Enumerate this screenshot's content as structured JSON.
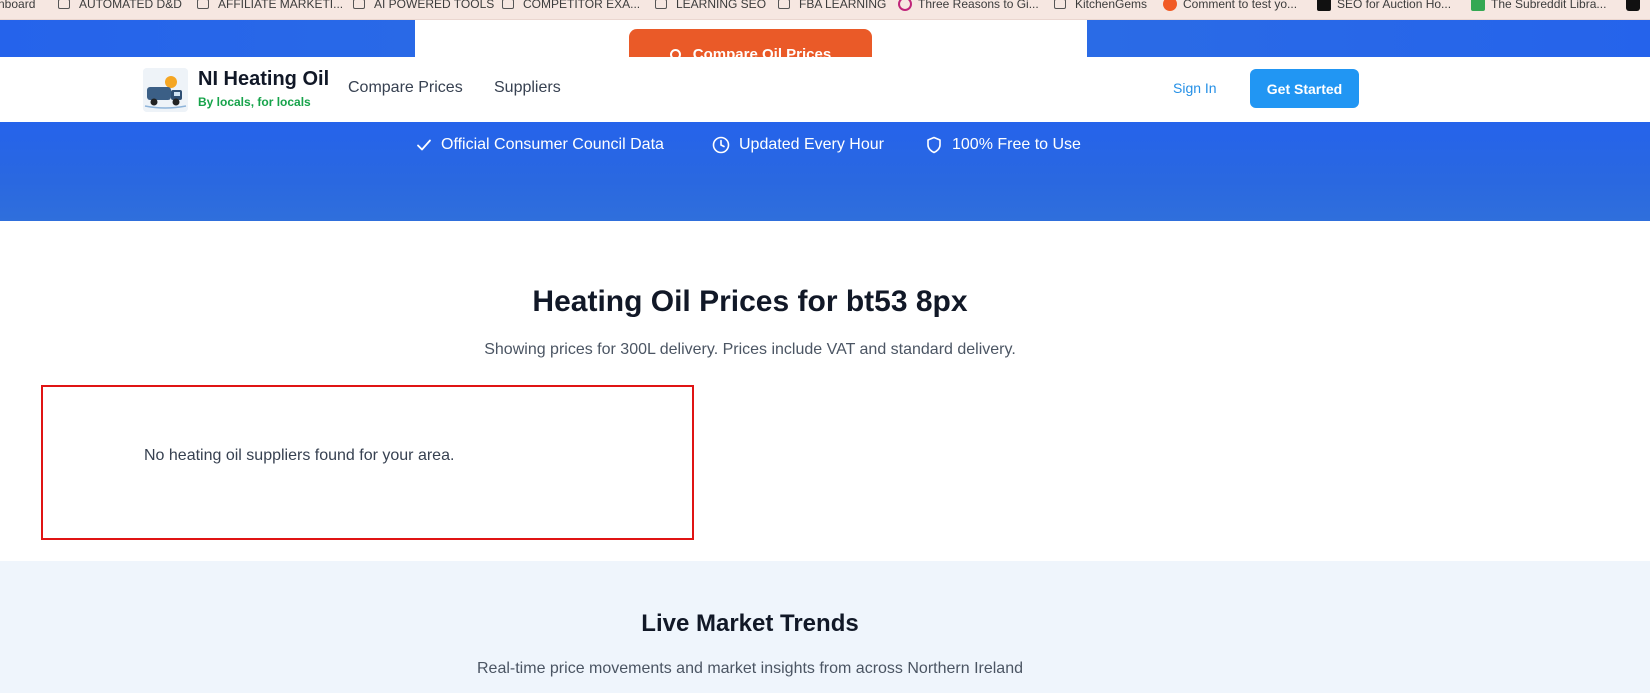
{
  "bookmarks": [
    {
      "label": "nboard",
      "icon": "none"
    },
    {
      "label": "AUTOMATED D&D",
      "icon": "folder-icon"
    },
    {
      "label": "AFFILIATE MARKETI...",
      "icon": "folder-icon"
    },
    {
      "label": "AI POWERED TOOLS",
      "icon": "folder-icon"
    },
    {
      "label": "COMPETITOR EXA...",
      "icon": "folder-icon"
    },
    {
      "label": "LEARNING SEO",
      "icon": "folder-icon"
    },
    {
      "label": "FBA LEARNING",
      "icon": "folder-icon"
    },
    {
      "label": "Three Reasons to Gi...",
      "icon": "site-favicon"
    },
    {
      "label": "KitchenGems",
      "icon": "folder-icon"
    },
    {
      "label": "Comment to test yo...",
      "icon": "site-favicon"
    },
    {
      "label": "SEO for Auction Ho...",
      "icon": "site-favicon"
    },
    {
      "label": "The Subreddit Libra...",
      "icon": "site-favicon"
    }
  ],
  "hero": {
    "compare_button": "Compare Oil Prices",
    "features": [
      {
        "label": "Official Consumer Council Data",
        "icon": "check-icon"
      },
      {
        "label": "Updated Every Hour",
        "icon": "clock-icon"
      },
      {
        "label": "100% Free to Use",
        "icon": "shield-icon"
      }
    ]
  },
  "nav": {
    "brand_title": "NI Heating Oil",
    "brand_tagline": "By locals, for locals",
    "links": [
      "Compare Prices",
      "Suppliers"
    ],
    "sign_in": "Sign In",
    "get_started": "Get Started"
  },
  "main": {
    "title": "Heating Oil Prices for bt53 8px",
    "subtitle": "Showing prices for 300L delivery. Prices include VAT and standard delivery.",
    "no_results": "No heating oil suppliers found for your area."
  },
  "trends": {
    "title": "Live Market Trends",
    "subtitle": "Real-time price movements and market insights from across Northern Ireland"
  },
  "colors": {
    "brand_blue": "#2563eb",
    "accent_orange": "#ea5a28",
    "button_blue": "#2196f3",
    "tagline_green": "#16a34a",
    "highlight_red": "#e01414"
  }
}
